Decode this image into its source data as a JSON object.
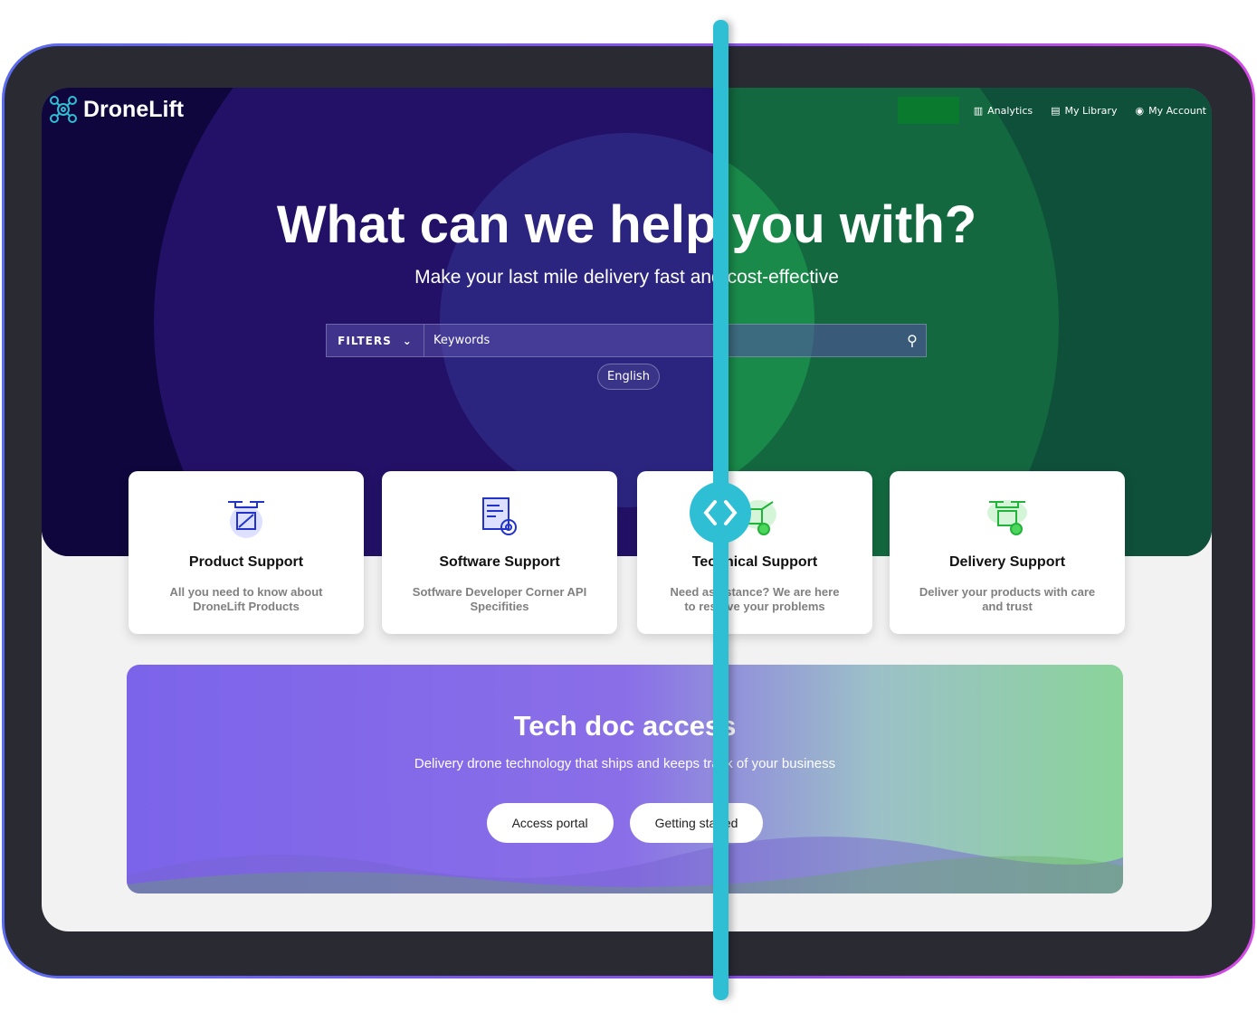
{
  "brand": {
    "name": "DroneLift"
  },
  "nav": {
    "items": [
      {
        "label": "Analytics",
        "icon": "chart-icon"
      },
      {
        "label": "My Library",
        "icon": "library-icon"
      },
      {
        "label": "My Account",
        "icon": "account-icon"
      }
    ]
  },
  "hero": {
    "title": "What can we help you with?",
    "subtitle": "Make your last mile delivery fast and cost-effective"
  },
  "search": {
    "filters_label": "FILTERS",
    "placeholder": "Keywords",
    "language": "English"
  },
  "cards": [
    {
      "title": "Product Support",
      "desc": "All you need to know about DroneLift Products"
    },
    {
      "title": "Software Support",
      "desc": "Sotfware Developer Corner API Specifities"
    },
    {
      "title": "Technical Support",
      "desc": "Need assistance? We are here to resolve your problems"
    },
    {
      "title": "Delivery Support",
      "desc": "Deliver your products with care and trust"
    }
  ],
  "banner": {
    "title": "Tech doc access",
    "subtitle": "Delivery drone technology that ships and keeps track of your business",
    "buttons": [
      "Access portal",
      "Getting started"
    ]
  },
  "colors": {
    "slider": "#2fbfd4",
    "purple_theme": "#221166",
    "green_theme": "#13683f"
  }
}
